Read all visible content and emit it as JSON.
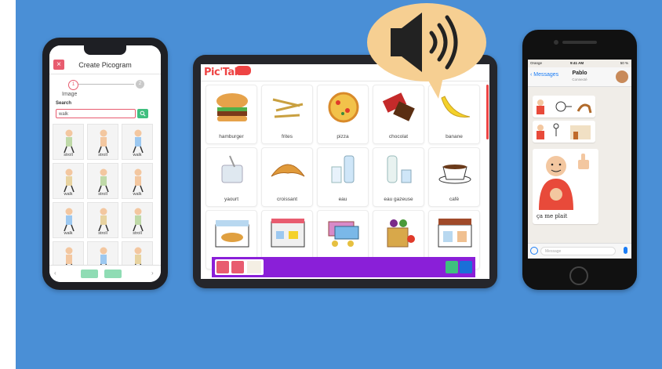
{
  "colors": {
    "background": "#4a8fd6",
    "accent_red": "#e85c6f",
    "accent_green": "#3fbf7f",
    "tablet_bar": "#8a1fd8",
    "bubble": "#f6cf92"
  },
  "left_phone": {
    "title": "Create Picogram",
    "step_label": "Image",
    "step1": "1",
    "step2": "2",
    "search_label": "Search",
    "search_value": "walk",
    "grid": [
      {
        "label": "stroll",
        "icon": "person-walking-tree-icon"
      },
      {
        "label": "stroll",
        "icon": "person-walking-tree-icon"
      },
      {
        "label": "walk",
        "icon": "stick-figure-walk-icon"
      },
      {
        "label": "walk",
        "icon": "person-walking-blue-icon"
      },
      {
        "label": "stroll",
        "icon": "family-stroll-icon"
      },
      {
        "label": "walk",
        "icon": "bride-walk-icon"
      },
      {
        "label": "walk",
        "icon": "person-walk-icon"
      },
      {
        "label": "stroll",
        "icon": "wheelchair-stroll-icon"
      },
      {
        "label": "stroll",
        "icon": "shop-stroll-icon"
      },
      {
        "label": "",
        "icon": "person-red-icon"
      },
      {
        "label": "",
        "icon": "person-red-icon"
      },
      {
        "label": "",
        "icon": "person-red-icon"
      }
    ]
  },
  "tablet": {
    "logo": "Pic'Talk",
    "cards": [
      {
        "label": "hamburger",
        "icon": "hamburger-icon"
      },
      {
        "label": "frites",
        "icon": "fries-icon"
      },
      {
        "label": "pizza",
        "icon": "pizza-icon"
      },
      {
        "label": "chocolat",
        "icon": "chocolate-icon"
      },
      {
        "label": "banane",
        "icon": "banana-icon"
      },
      {
        "label": "yaourt",
        "icon": "yogurt-icon"
      },
      {
        "label": "croissant",
        "icon": "croissant-icon"
      },
      {
        "label": "eau",
        "icon": "water-icon"
      },
      {
        "label": "eau gazeuse",
        "icon": "sparkling-water-icon"
      },
      {
        "label": "café",
        "icon": "coffee-icon"
      },
      {
        "label": "",
        "icon": "bakery-icon"
      },
      {
        "label": "",
        "icon": "shop-icon"
      },
      {
        "label": "",
        "icon": "money-icon"
      },
      {
        "label": "",
        "icon": "groceries-icon"
      },
      {
        "label": "",
        "icon": "store-icon"
      }
    ]
  },
  "right_phone": {
    "carrier": "Orange",
    "time": "9:41 AM",
    "battery": "50 %",
    "back_label": "Messages",
    "contact_name": "Pablo",
    "contact_status": "Connecté",
    "message_caption": "ça me plait",
    "input_placeholder": "Message"
  }
}
